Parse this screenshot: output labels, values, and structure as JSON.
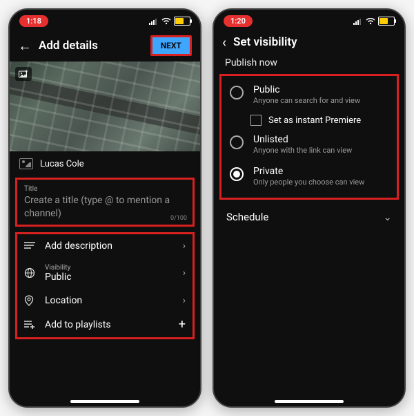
{
  "left": {
    "time": "1:18",
    "header_title": "Add details",
    "next_label": "NEXT",
    "channel_name": "Lucas Cole",
    "title_label": "Title",
    "title_placeholder": "Create a title (type @ to mention a channel)",
    "title_counter": "0/100",
    "options": {
      "description": "Add description",
      "visibility_label": "Visibility",
      "visibility_value": "Public",
      "location": "Location",
      "playlists": "Add to playlists"
    }
  },
  "right": {
    "time": "1:20",
    "header_title": "Set visibility",
    "section": "Publish now",
    "public": {
      "label": "Public",
      "desc": "Anyone can search for and view"
    },
    "premiere_label": "Set as instant Premiere",
    "unlisted": {
      "label": "Unlisted",
      "desc": "Anyone with the link can view"
    },
    "private": {
      "label": "Private",
      "desc": "Only people you choose can view"
    },
    "selected": "private",
    "schedule": "Schedule"
  }
}
